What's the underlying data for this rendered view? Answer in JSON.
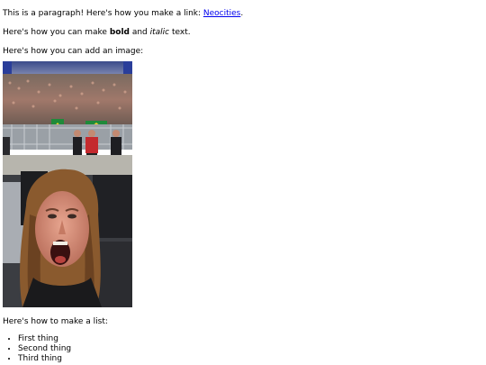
{
  "content": {
    "paragraph_prefix": "This is a paragraph! Here's how you make a link: ",
    "link_text": "Neocities",
    "paragraph_suffix": ".",
    "format_prefix": "Here's how you can make ",
    "bold_text": "bold",
    "and_text": " and ",
    "italic_text": "italic",
    "format_suffix": " text.",
    "image_intro": "Here's how you can add an image:",
    "list_intro": "Here's how to make a list:",
    "list_items": [
      "First thing",
      "Second thing",
      "Third thing"
    ]
  },
  "colors": {
    "link": "#0000ee",
    "text": "#000000",
    "background": "#ffffff"
  }
}
